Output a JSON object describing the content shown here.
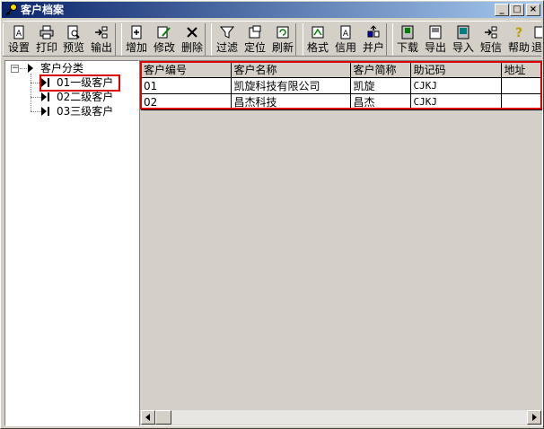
{
  "window": {
    "title": "客户档案",
    "accent": "#0a246a",
    "highlight_color": "#e00000"
  },
  "window_controls": {
    "minimize": "_",
    "maximize": "□",
    "close": "×"
  },
  "toolbar": {
    "groups": [
      [
        {
          "label": "设置",
          "icon": "settings-doc-icon"
        },
        {
          "label": "打印",
          "icon": "printer-icon"
        },
        {
          "label": "预览",
          "icon": "preview-icon"
        },
        {
          "label": "输出",
          "icon": "export-arrow-icon"
        }
      ],
      [
        {
          "label": "增加",
          "icon": "add-doc-icon"
        },
        {
          "label": "修改",
          "icon": "edit-icon"
        },
        {
          "label": "删除",
          "icon": "delete-x-icon"
        }
      ],
      [
        {
          "label": "过滤",
          "icon": "filter-funnel-icon"
        },
        {
          "label": "定位",
          "icon": "locate-icon"
        },
        {
          "label": "刷新",
          "icon": "refresh-icon"
        }
      ],
      [
        {
          "label": "格式",
          "icon": "format-icon"
        },
        {
          "label": "信用",
          "icon": "credit-icon"
        },
        {
          "label": "并户",
          "icon": "merge-icon"
        }
      ],
      [
        {
          "label": "下载",
          "icon": "download-icon"
        },
        {
          "label": "导出",
          "icon": "export-icon"
        },
        {
          "label": "导入",
          "icon": "import-icon"
        },
        {
          "label": "短信",
          "icon": "sms-icon"
        },
        {
          "label": "帮助",
          "icon": "help-icon"
        },
        {
          "label": "退",
          "icon": "exit-icon"
        }
      ]
    ]
  },
  "tree": {
    "root": {
      "label": "客户分类",
      "expander": "−"
    },
    "children": [
      {
        "label": "01一级客户"
      },
      {
        "label": "02二级客户"
      },
      {
        "label": "03三级客户"
      }
    ]
  },
  "grid": {
    "columns": [
      "客户编号",
      "客户名称",
      "客户简称",
      "助记码",
      "地址"
    ],
    "rows": [
      [
        "01",
        "凯旋科技有限公司",
        "凯旋",
        "CJKJ",
        ""
      ],
      [
        "02",
        "昌杰科技",
        "昌杰",
        "CJKJ",
        ""
      ]
    ]
  },
  "hscroll": {
    "left_arrow": "◂",
    "right_arrow": "▸"
  }
}
